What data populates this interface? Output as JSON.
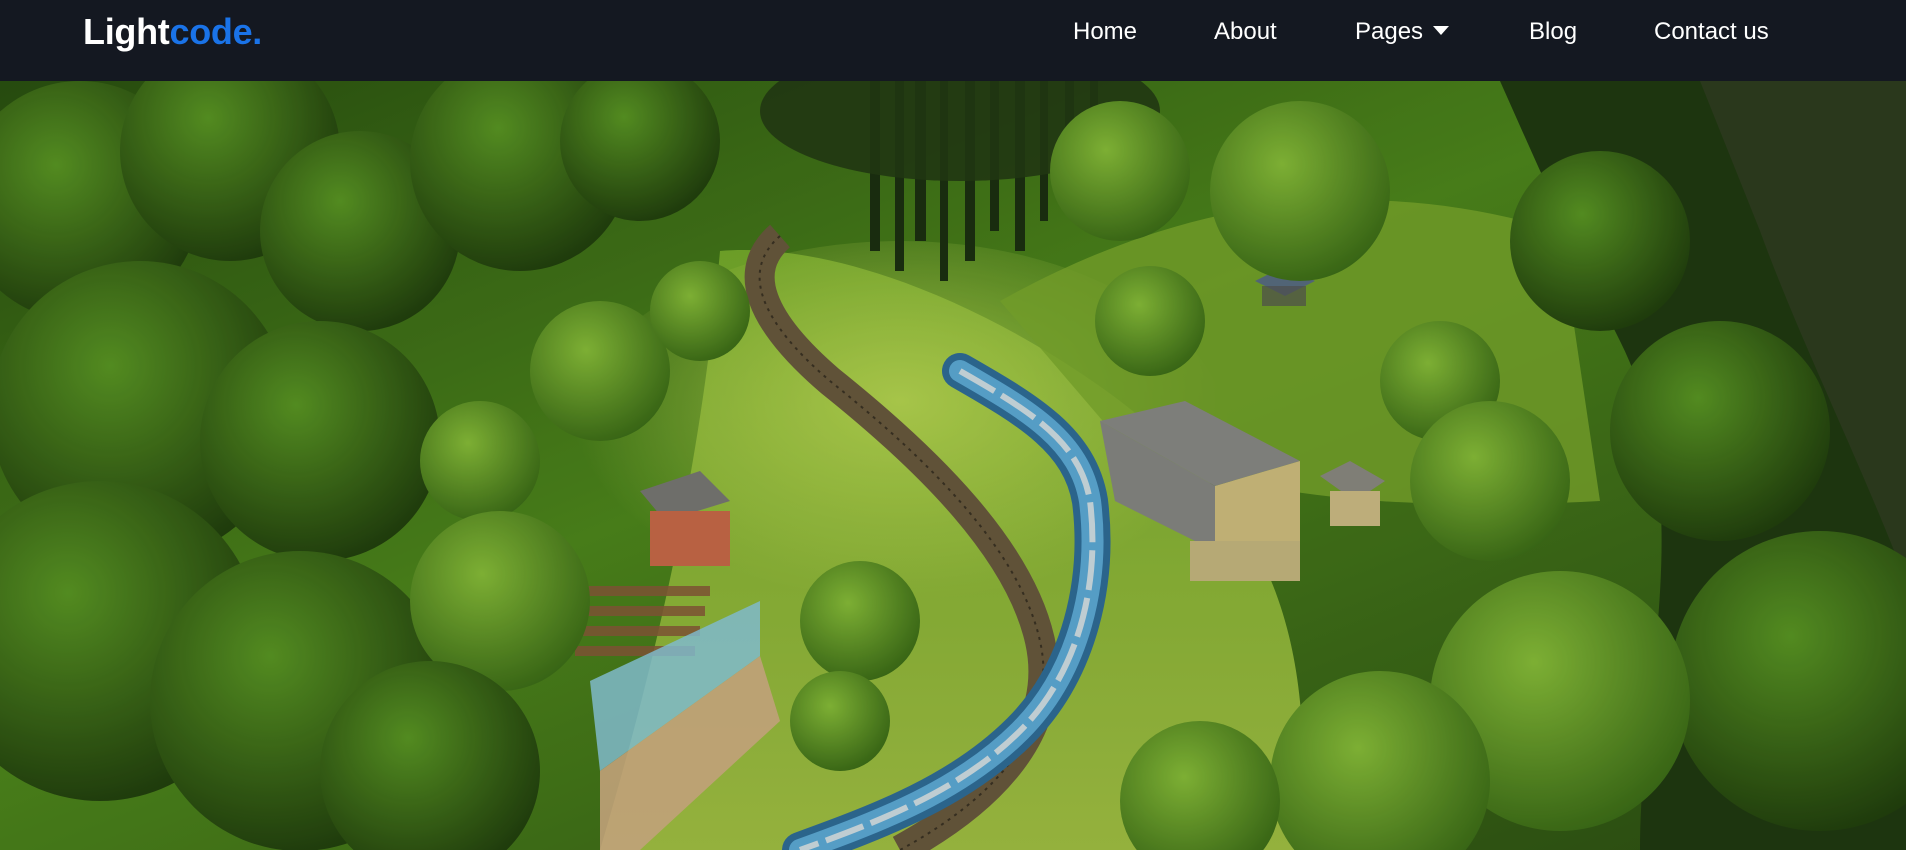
{
  "brand": {
    "part1": "Light",
    "part2": "code."
  },
  "nav": {
    "items": [
      {
        "label": "Home"
      },
      {
        "label": "About"
      },
      {
        "label": "Pages"
      },
      {
        "label": "Blog"
      },
      {
        "label": "Contact us"
      }
    ]
  },
  "colors": {
    "nav_background": "#141821",
    "brand_accent": "#1a73e8",
    "nav_text": "#ffffff"
  },
  "icons": {
    "pages_dropdown": "caret-down-icon"
  }
}
